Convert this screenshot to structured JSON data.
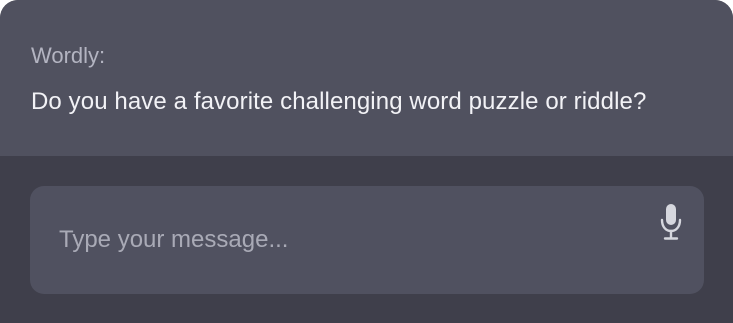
{
  "chat": {
    "sender": "Wordly:",
    "message": "Do you have a favorite challenging word puzzle or riddle?"
  },
  "composer": {
    "placeholder": "Type your message...",
    "value": "",
    "mic_icon": "microphone-icon"
  },
  "colors": {
    "background": "#3f3f4b",
    "message_panel": "#50515f",
    "composer": "#505160",
    "text": "#f2f2f6",
    "muted_text": "#b3b4c1",
    "icon": "#d6d7de"
  }
}
